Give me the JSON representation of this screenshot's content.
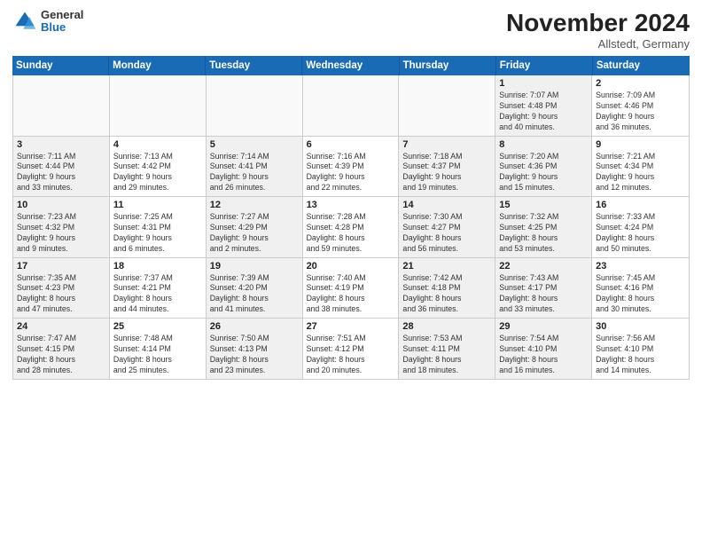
{
  "header": {
    "title": "November 2024",
    "location": "Allstedt, Germany",
    "logo_general": "General",
    "logo_blue": "Blue"
  },
  "days_of_week": [
    "Sunday",
    "Monday",
    "Tuesday",
    "Wednesday",
    "Thursday",
    "Friday",
    "Saturday"
  ],
  "weeks": [
    [
      {
        "day": "",
        "empty": true
      },
      {
        "day": "",
        "empty": true
      },
      {
        "day": "",
        "empty": true
      },
      {
        "day": "",
        "empty": true
      },
      {
        "day": "",
        "empty": true
      },
      {
        "day": "1",
        "info": "Sunrise: 7:07 AM\nSunset: 4:48 PM\nDaylight: 9 hours\nand 40 minutes.",
        "shaded": true
      },
      {
        "day": "2",
        "info": "Sunrise: 7:09 AM\nSunset: 4:46 PM\nDaylight: 9 hours\nand 36 minutes."
      }
    ],
    [
      {
        "day": "3",
        "info": "Sunrise: 7:11 AM\nSunset: 4:44 PM\nDaylight: 9 hours\nand 33 minutes.",
        "shaded": true
      },
      {
        "day": "4",
        "info": "Sunrise: 7:13 AM\nSunset: 4:42 PM\nDaylight: 9 hours\nand 29 minutes."
      },
      {
        "day": "5",
        "info": "Sunrise: 7:14 AM\nSunset: 4:41 PM\nDaylight: 9 hours\nand 26 minutes.",
        "shaded": true
      },
      {
        "day": "6",
        "info": "Sunrise: 7:16 AM\nSunset: 4:39 PM\nDaylight: 9 hours\nand 22 minutes."
      },
      {
        "day": "7",
        "info": "Sunrise: 7:18 AM\nSunset: 4:37 PM\nDaylight: 9 hours\nand 19 minutes.",
        "shaded": true
      },
      {
        "day": "8",
        "info": "Sunrise: 7:20 AM\nSunset: 4:36 PM\nDaylight: 9 hours\nand 15 minutes.",
        "shaded": true
      },
      {
        "day": "9",
        "info": "Sunrise: 7:21 AM\nSunset: 4:34 PM\nDaylight: 9 hours\nand 12 minutes."
      }
    ],
    [
      {
        "day": "10",
        "info": "Sunrise: 7:23 AM\nSunset: 4:32 PM\nDaylight: 9 hours\nand 9 minutes.",
        "shaded": true
      },
      {
        "day": "11",
        "info": "Sunrise: 7:25 AM\nSunset: 4:31 PM\nDaylight: 9 hours\nand 6 minutes."
      },
      {
        "day": "12",
        "info": "Sunrise: 7:27 AM\nSunset: 4:29 PM\nDaylight: 9 hours\nand 2 minutes.",
        "shaded": true
      },
      {
        "day": "13",
        "info": "Sunrise: 7:28 AM\nSunset: 4:28 PM\nDaylight: 8 hours\nand 59 minutes."
      },
      {
        "day": "14",
        "info": "Sunrise: 7:30 AM\nSunset: 4:27 PM\nDaylight: 8 hours\nand 56 minutes.",
        "shaded": true
      },
      {
        "day": "15",
        "info": "Sunrise: 7:32 AM\nSunset: 4:25 PM\nDaylight: 8 hours\nand 53 minutes.",
        "shaded": true
      },
      {
        "day": "16",
        "info": "Sunrise: 7:33 AM\nSunset: 4:24 PM\nDaylight: 8 hours\nand 50 minutes."
      }
    ],
    [
      {
        "day": "17",
        "info": "Sunrise: 7:35 AM\nSunset: 4:23 PM\nDaylight: 8 hours\nand 47 minutes.",
        "shaded": true
      },
      {
        "day": "18",
        "info": "Sunrise: 7:37 AM\nSunset: 4:21 PM\nDaylight: 8 hours\nand 44 minutes."
      },
      {
        "day": "19",
        "info": "Sunrise: 7:39 AM\nSunset: 4:20 PM\nDaylight: 8 hours\nand 41 minutes.",
        "shaded": true
      },
      {
        "day": "20",
        "info": "Sunrise: 7:40 AM\nSunset: 4:19 PM\nDaylight: 8 hours\nand 38 minutes."
      },
      {
        "day": "21",
        "info": "Sunrise: 7:42 AM\nSunset: 4:18 PM\nDaylight: 8 hours\nand 36 minutes.",
        "shaded": true
      },
      {
        "day": "22",
        "info": "Sunrise: 7:43 AM\nSunset: 4:17 PM\nDaylight: 8 hours\nand 33 minutes.",
        "shaded": true
      },
      {
        "day": "23",
        "info": "Sunrise: 7:45 AM\nSunset: 4:16 PM\nDaylight: 8 hours\nand 30 minutes."
      }
    ],
    [
      {
        "day": "24",
        "info": "Sunrise: 7:47 AM\nSunset: 4:15 PM\nDaylight: 8 hours\nand 28 minutes.",
        "shaded": true
      },
      {
        "day": "25",
        "info": "Sunrise: 7:48 AM\nSunset: 4:14 PM\nDaylight: 8 hours\nand 25 minutes."
      },
      {
        "day": "26",
        "info": "Sunrise: 7:50 AM\nSunset: 4:13 PM\nDaylight: 8 hours\nand 23 minutes.",
        "shaded": true
      },
      {
        "day": "27",
        "info": "Sunrise: 7:51 AM\nSunset: 4:12 PM\nDaylight: 8 hours\nand 20 minutes."
      },
      {
        "day": "28",
        "info": "Sunrise: 7:53 AM\nSunset: 4:11 PM\nDaylight: 8 hours\nand 18 minutes.",
        "shaded": true
      },
      {
        "day": "29",
        "info": "Sunrise: 7:54 AM\nSunset: 4:10 PM\nDaylight: 8 hours\nand 16 minutes.",
        "shaded": true
      },
      {
        "day": "30",
        "info": "Sunrise: 7:56 AM\nSunset: 4:10 PM\nDaylight: 8 hours\nand 14 minutes."
      }
    ]
  ]
}
